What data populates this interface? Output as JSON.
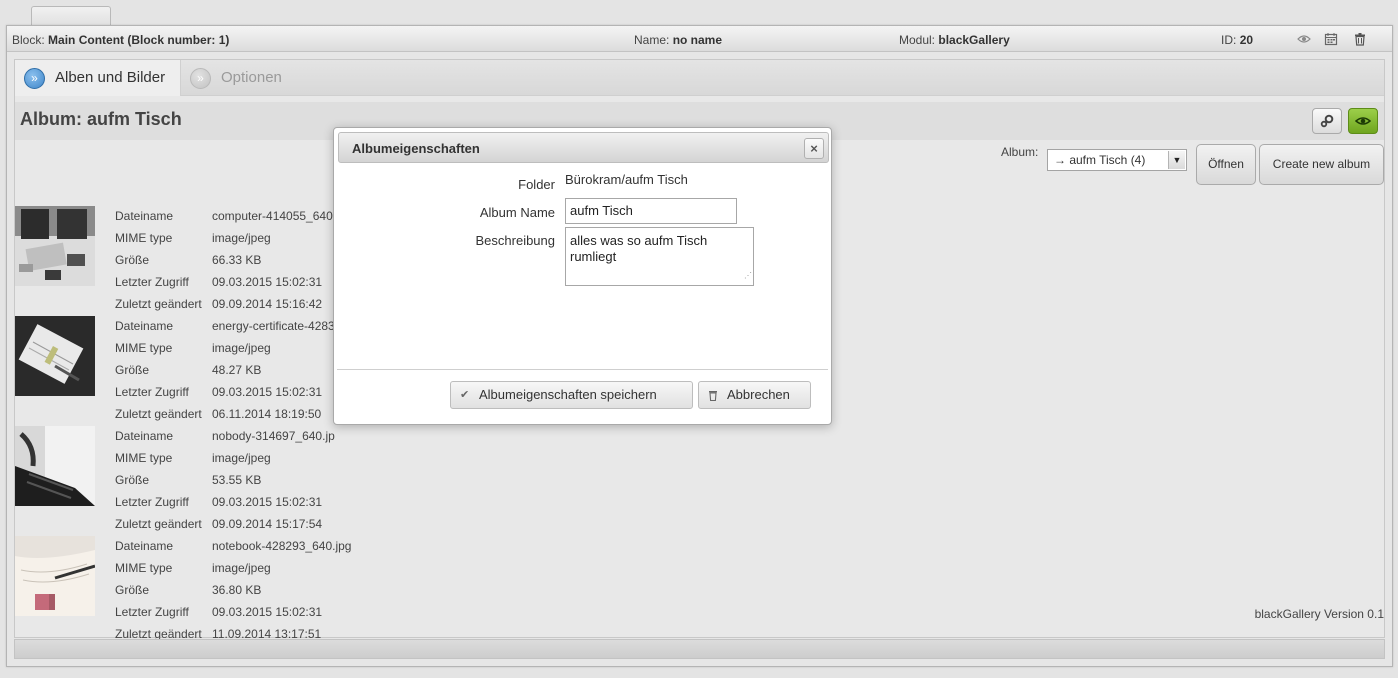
{
  "header": {
    "block_label": "Block:",
    "block_value": "Main Content (Block number: 1)",
    "name_label": "Name:",
    "name_value": "no name",
    "modul_label": "Modul:",
    "modul_value": "blackGallery",
    "id_label": "ID:",
    "id_value": "20",
    "icons": [
      "eye-icon",
      "calendar-icon",
      "trash-icon"
    ]
  },
  "tabs": [
    {
      "label": "Alben und Bilder",
      "active": true
    },
    {
      "label": "Optionen",
      "active": false
    }
  ],
  "album_bar": {
    "title": "Album: aufm Tisch",
    "buttons": [
      "settings-icon",
      "eye-icon"
    ]
  },
  "album_selector": {
    "label": "Album:",
    "selected": "→ aufm Tisch (4)",
    "open_button": "Öffnen",
    "create_button": "Create new album"
  },
  "images": [
    {
      "fields": [
        {
          "key": "Dateiname",
          "value": "computer-414055_640"
        },
        {
          "key": "MIME type",
          "value": "image/jpeg"
        },
        {
          "key": "Größe",
          "value": "66.33 KB"
        },
        {
          "key": "Letzter Zugriff",
          "value": "09.03.2015 15:02:31"
        },
        {
          "key": "Zuletzt geändert",
          "value": "09.09.2014 15:16:42"
        }
      ]
    },
    {
      "fields": [
        {
          "key": "Dateiname",
          "value": "energy-certificate-4283"
        },
        {
          "key": "MIME type",
          "value": "image/jpeg"
        },
        {
          "key": "Größe",
          "value": "48.27 KB"
        },
        {
          "key": "Letzter Zugriff",
          "value": "09.03.2015 15:02:31"
        },
        {
          "key": "Zuletzt geändert",
          "value": "06.11.2014 18:19:50"
        }
      ]
    },
    {
      "fields": [
        {
          "key": "Dateiname",
          "value": "nobody-314697_640.jp"
        },
        {
          "key": "MIME type",
          "value": "image/jpeg"
        },
        {
          "key": "Größe",
          "value": "53.55 KB"
        },
        {
          "key": "Letzter Zugriff",
          "value": "09.03.2015 15:02:31"
        },
        {
          "key": "Zuletzt geändert",
          "value": "09.09.2014 15:17:54"
        }
      ]
    },
    {
      "fields": [
        {
          "key": "Dateiname",
          "value": "notebook-428293_640.jpg"
        },
        {
          "key": "MIME type",
          "value": "image/jpeg"
        },
        {
          "key": "Größe",
          "value": "36.80 KB"
        },
        {
          "key": "Letzter Zugriff",
          "value": "09.03.2015 15:02:31"
        },
        {
          "key": "Zuletzt geändert",
          "value": "11.09.2014 13:17:51"
        }
      ]
    }
  ],
  "version": "blackGallery Version 0.1",
  "modal": {
    "title": "Albumeigenschaften",
    "close": "×",
    "folder_label": "Folder",
    "folder_value": "Bürokram/aufm Tisch",
    "name_label": "Album Name",
    "name_value": "aufm Tisch",
    "desc_label": "Beschreibung",
    "desc_value": "alles was so aufm Tisch rumliegt",
    "save_button": "Albumeigenschaften speichern",
    "cancel_button": "Abbrechen"
  },
  "colors": {
    "accent_blue": "#3f86c9",
    "accent_green": "#7fb82d",
    "background": "#e4e4e4"
  }
}
